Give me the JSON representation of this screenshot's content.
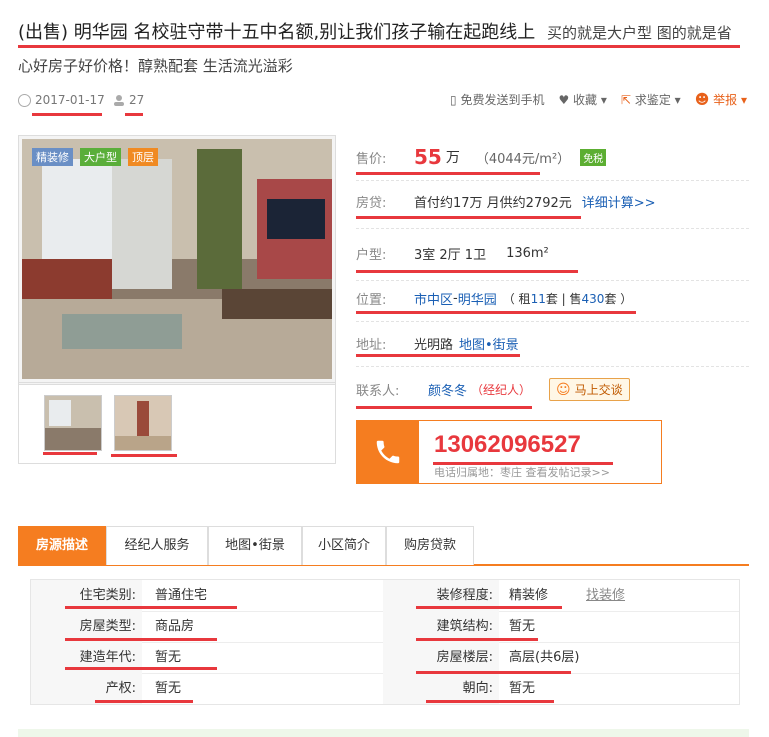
{
  "header": {
    "title_main": "(出售) 明华园 名校驻守带十五中名额,别让我们孩子输在起跑线上",
    "title_sub": "买的就是大户型 图的就是省",
    "subtitle": "心好房子好价格！醇熟配套 生活流光溢彩",
    "date": "2017-01-17",
    "views": "27"
  },
  "actions": {
    "send_phone": "免费发送到手机",
    "favorite": "收藏",
    "appraise": "求鉴定",
    "report": "举报"
  },
  "photo": {
    "tags": [
      "精装修",
      "大户型",
      "顶层"
    ]
  },
  "info": {
    "price_label": "售价:",
    "price_value": "55",
    "price_unit": "万",
    "price_per": "（4044元/m²）",
    "tax_badge": "免税",
    "loan_label": "房贷:",
    "loan_text": "首付约17万  月供约2792元",
    "loan_link": "详细计算>>",
    "type_label": "户型:",
    "type_value": "3室 2厅 1卫",
    "area_value": "136m²",
    "loc_label": "位置:",
    "loc_district": "市中区",
    "loc_sep": " - ",
    "loc_estate": "明华园",
    "loc_rent_pre": "（ 租 ",
    "loc_rent": "11",
    "loc_mid": " 套 | 售 ",
    "loc_sale": "430",
    "loc_suffix": " 套 ）",
    "addr_label": "地址:",
    "addr_value": "光明路",
    "addr_link": "地图•街景",
    "contact_label": "联系人:",
    "contact_name": "颜冬冬",
    "contact_role": "（经纪人）",
    "chat_label": "马上交谈"
  },
  "phone": {
    "number": "13062096527",
    "sub_text": "电话归属地：枣庄    查看发帖记录>>"
  },
  "tabs": [
    "房源描述",
    "经纪人服务",
    "地图•街景",
    "小区简介",
    "购房贷款"
  ],
  "details": {
    "left": [
      {
        "label": "住宅类别:",
        "value": "普通住宅"
      },
      {
        "label": "房屋类型:",
        "value": "商品房"
      },
      {
        "label": "建造年代:",
        "value": "暂无"
      },
      {
        "label": "产权:",
        "value": "暂无"
      }
    ],
    "right": [
      {
        "label": "装修程度:",
        "value": "精装修",
        "link": "找装修"
      },
      {
        "label": "建筑结构:",
        "value": "暂无"
      },
      {
        "label": "房屋楼层:",
        "value": "高层(共6层)"
      },
      {
        "label": "朝向:",
        "value": "暂无"
      }
    ]
  },
  "colors": {
    "accent_orange": "#f57d20",
    "price_red": "#e8383d",
    "link_blue": "#1a5fb4",
    "annotation_red": "#e8383d"
  }
}
